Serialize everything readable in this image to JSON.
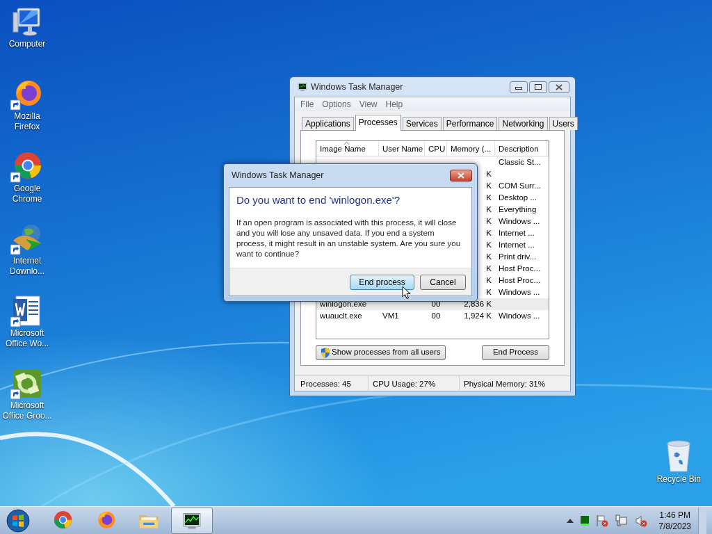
{
  "desktop_icons": [
    {
      "kind": "computer",
      "label": "Computer"
    },
    {
      "kind": "firefox",
      "label": "Mozilla Firefox"
    },
    {
      "kind": "chrome",
      "label": "Google Chrome"
    },
    {
      "kind": "idm",
      "label": "Internet Downlo..."
    },
    {
      "kind": "word",
      "label": "Microsoft Office Wo..."
    },
    {
      "kind": "groove",
      "label": "Microsoft Office Groo..."
    }
  ],
  "recycle_bin": {
    "label": "Recycle Bin"
  },
  "task_manager": {
    "title": "Windows Task Manager",
    "menu": [
      "File",
      "Options",
      "View",
      "Help"
    ],
    "tabs": [
      {
        "label": "Applications",
        "selected": false
      },
      {
        "label": "Processes",
        "selected": true
      },
      {
        "label": "Services",
        "selected": false
      },
      {
        "label": "Performance",
        "selected": false
      },
      {
        "label": "Networking",
        "selected": false
      },
      {
        "label": "Users",
        "selected": false
      }
    ],
    "columns": [
      "Image Name",
      "User Name",
      "CPU",
      "Memory (...",
      "Description"
    ],
    "rows": [
      {
        "description": "Classic St...",
        "selected": false
      },
      {
        "memory": "K",
        "selected": false
      },
      {
        "memory": "K",
        "description": "COM Surr...",
        "selected": false
      },
      {
        "memory": "K",
        "description": "Desktop ...",
        "selected": false
      },
      {
        "memory": "K",
        "description": "Everything",
        "selected": false
      },
      {
        "memory": "K",
        "description": "Windows ...",
        "selected": false
      },
      {
        "memory": "K",
        "description": "Internet ...",
        "selected": false
      },
      {
        "memory": "K",
        "description": "Internet ...",
        "selected": false
      },
      {
        "memory": "K",
        "description": "Print driv...",
        "selected": false
      },
      {
        "memory": "K",
        "description": "Host Proc...",
        "selected": false
      },
      {
        "memory": "K",
        "description": "Host Proc...",
        "selected": false
      },
      {
        "memory": "K",
        "description": "Windows ...",
        "selected": false
      },
      {
        "image_name": "winlogon.exe",
        "cpu": "00",
        "memory": "2,836 K",
        "selected": true
      },
      {
        "image_name": "wuauclt.exe",
        "user_name": "VM1",
        "cpu": "00",
        "memory": "1,924 K",
        "description": "Windows ...",
        "selected": false
      }
    ],
    "show_all_button": "Show processes from all users",
    "end_process_button": "End Process",
    "status_bar": [
      "Processes: 45",
      "CPU Usage: 27%",
      "Physical Memory: 31%"
    ]
  },
  "dialog": {
    "title": "Windows Task Manager",
    "heading": "Do you want to end 'winlogon.exe'?",
    "message": "If an open program is associated with this process, it will close and you will lose any unsaved data. If you end a system process, it might result in an unstable system. Are you sure you want to continue?",
    "buttons": [
      {
        "label": "End process",
        "default": true
      },
      {
        "label": "Cancel",
        "default": false
      }
    ]
  },
  "taskbar": {
    "items": [
      {
        "kind": "chrome",
        "active": false
      },
      {
        "kind": "firefox",
        "active": false
      },
      {
        "kind": "folder",
        "active": false
      },
      {
        "kind": "taskmanager",
        "active": true
      }
    ],
    "time": "1:46 PM",
    "date": "7/8/2023"
  }
}
